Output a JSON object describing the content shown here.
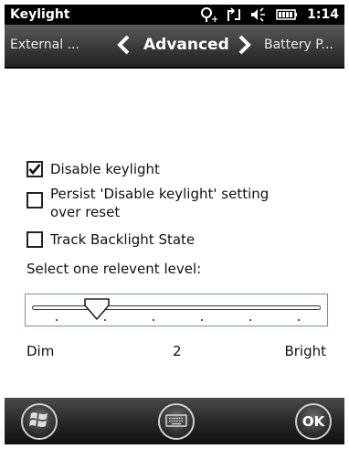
{
  "status_bar": {
    "title": "Keylight",
    "time": "1:14"
  },
  "tabs": {
    "left": "External ...",
    "center": "Advanced",
    "right": "Battery P..."
  },
  "options": [
    {
      "label": "Disable keylight",
      "checked": true
    },
    {
      "label": "Persist 'Disable keylight' setting over reset",
      "checked": false
    },
    {
      "label": "Track Backlight State",
      "checked": false
    }
  ],
  "level": {
    "label": "Select one relevent level:",
    "min_label": "Dim",
    "max_label": "Bright",
    "value": "2",
    "min": 1,
    "max": 7
  },
  "bottom_bar": {
    "ok_label": "OK"
  },
  "icons": {
    "status": [
      "connectivity-icon",
      "sync-icon",
      "volume-icon",
      "battery-icon"
    ],
    "tabs": [
      "chevron-left-icon",
      "chevron-right-icon"
    ],
    "bottom": [
      "windows-start-icon",
      "keyboard-icon"
    ]
  },
  "colors": {
    "slider_border": "#6b8ccf",
    "status_bar_bg": "#000000"
  }
}
